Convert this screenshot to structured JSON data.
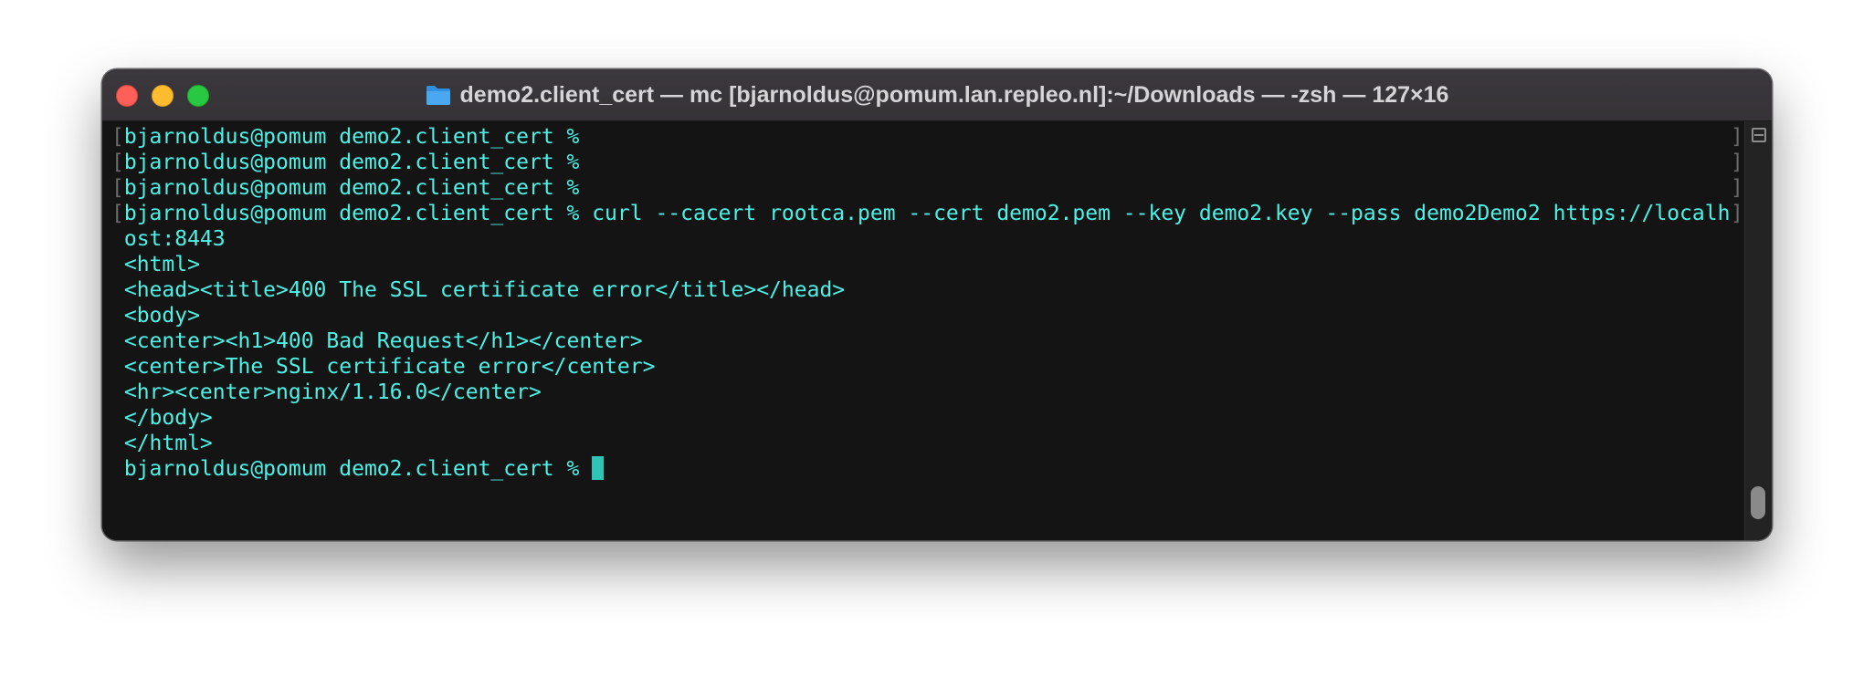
{
  "window": {
    "title": "demo2.client_cert — mc [bjarnoldus@pomum.lan.repleo.nl]:~/Downloads — -zsh — 127×16",
    "title_icon": "folder-icon",
    "controls": [
      "close",
      "minimize",
      "zoom"
    ]
  },
  "terminal": {
    "colors": {
      "text": "#4df2e6",
      "background": "#141414",
      "cursor": "#2fc4b6",
      "mark": "#6a6a6a"
    },
    "prompt_lines": [
      {
        "mark": "[",
        "text": "bjarnoldus@pomum demo2.client_cert %"
      },
      {
        "mark": "[",
        "text": "bjarnoldus@pomum demo2.client_cert %"
      },
      {
        "mark": "[",
        "text": "bjarnoldus@pomum demo2.client_cert %"
      },
      {
        "mark": "[",
        "text": "bjarnoldus@pomum demo2.client_cert % curl --cacert rootca.pem --cert demo2.pem --key demo2.key --pass demo2Demo2 https://localh"
      }
    ],
    "output_lines": [
      " ost:8443",
      " <html>",
      " <head><title>400 The SSL certificate error</title></head>",
      " <body>",
      " <center><h1>400 Bad Request</h1></center>",
      " <center>The SSL certificate error</center>",
      " <hr><center>nginx/1.16.0</center>",
      " </body>",
      " </html>"
    ],
    "current_prompt": " bjarnoldus@pomum demo2.client_cert % ",
    "right_marks": [
      "]",
      "]",
      "]",
      "]"
    ]
  },
  "scrollbar": {
    "icon": "split-pane-icon"
  }
}
